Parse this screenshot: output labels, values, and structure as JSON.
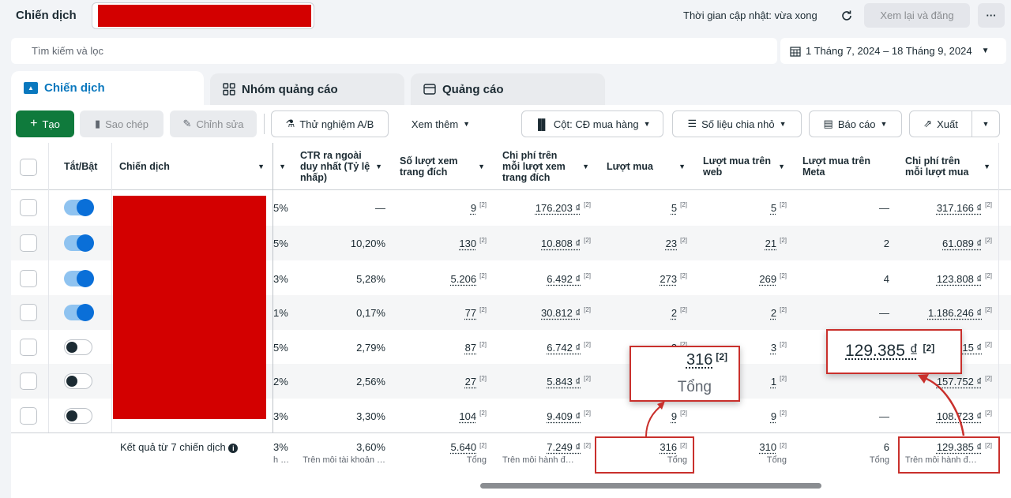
{
  "header": {
    "title": "Chiến dịch",
    "update_text": "Thời gian cập nhật: vừa xong",
    "review_label": "Xem lại và đăng",
    "more_label": "···"
  },
  "search": {
    "placeholder": "Tìm kiếm và lọc"
  },
  "date_range": {
    "label": "1 Tháng 7, 2024 – 18 Tháng 9, 2024"
  },
  "tabs": [
    {
      "label": "Chiến dịch"
    },
    {
      "label": "Nhóm quảng cáo"
    },
    {
      "label": "Quảng cáo"
    }
  ],
  "toolbar": {
    "create": "Tạo",
    "copy": "Sao chép",
    "edit": "Chỉnh sửa",
    "ab_test": "Thử nghiệm A/B",
    "see_more": "Xem thêm",
    "columns": "Cột: CĐ mua hàng",
    "breakdown": "Số liệu chia nhỏ",
    "report": "Báo cáo",
    "export": "Xuất"
  },
  "columns": {
    "toggle": "Tắt/Bật",
    "campaign": "Chiến dịch",
    "ctr": "CTR ra ngoài duy nhất (Tỷ lệ nhấp)",
    "views": "Số lượt xem trang đích",
    "cost_view": "Chi phí trên mỗi lượt xem trang đích",
    "purchases": "Lượt mua",
    "web_purchases": "Lượt mua trên web",
    "meta_purchases": "Lượt mua trên Meta",
    "cost_purchase": "Chi phí trên mỗi lượt mua"
  },
  "footnote": "[2]",
  "rows": [
    {
      "on": true,
      "pct": "5%",
      "ctr": "—",
      "views": "9",
      "cost_view": "176.203 ₫",
      "purchases": "5",
      "web": "5",
      "meta": "—",
      "cost_purchase": "317.166 ₫"
    },
    {
      "on": true,
      "pct": "5%",
      "ctr": "10,20%",
      "views": "130",
      "cost_view": "10.808 ₫",
      "purchases": "23",
      "web": "21",
      "meta": "2",
      "cost_purchase": "61.089 ₫"
    },
    {
      "on": true,
      "pct": "3%",
      "ctr": "5,28%",
      "views": "5.206",
      "cost_view": "6.492 ₫",
      "purchases": "273",
      "web": "269",
      "meta": "4",
      "cost_purchase": "123.808 ₫"
    },
    {
      "on": true,
      "pct": "1%",
      "ctr": "0,17%",
      "views": "77",
      "cost_view": "30.812 ₫",
      "purchases": "2",
      "web": "2",
      "meta": "—",
      "cost_purchase": "1.186.246 ₫"
    },
    {
      "on": false,
      "pct": "5%",
      "ctr": "2,79%",
      "views": "87",
      "cost_view": "6.742 ₫",
      "purchases": "3",
      "web": "3",
      "meta": "",
      "cost_purchase": "15 ₫"
    },
    {
      "on": false,
      "pct": "2%",
      "ctr": "2,56%",
      "views": "27",
      "cost_view": "5.843 ₫",
      "purchases": "",
      "web": "1",
      "meta": "",
      "cost_purchase": "157.752 ₫"
    },
    {
      "on": false,
      "pct": "3%",
      "ctr": "3,30%",
      "views": "104",
      "cost_view": "9.409 ₫",
      "purchases": "9",
      "web": "9",
      "meta": "—",
      "cost_purchase": "108.723 ₫"
    }
  ],
  "summary": {
    "label": "Kết quả từ 7 chiến dịch",
    "pct": "3%",
    "pct_sub": "h …",
    "ctr": "3,60%",
    "ctr_sub": "Trên mỗi tài khoản …",
    "views": "5.640",
    "views_sub": "Tổng",
    "cost_view": "7.249 ₫",
    "cost_view_sub": "Trên mỗi hành đ…",
    "purchases": "316",
    "purchases_sub": "Tổng",
    "web": "310",
    "web_sub": "Tổng",
    "meta": "6",
    "meta_sub": "Tổng",
    "cost_purchase": "129.385 ₫",
    "cost_purchase_sub": "Trên mỗi hành đ…"
  },
  "callouts": {
    "purchases_value": "316",
    "purchases_label": "Tổng",
    "cost_value": "129.385 ₫",
    "footnote": "[2]"
  },
  "colors": {
    "accent": "#0a78be",
    "create": "#0f7a3c",
    "redaction": "#d30000",
    "callout": "#c9302c"
  }
}
